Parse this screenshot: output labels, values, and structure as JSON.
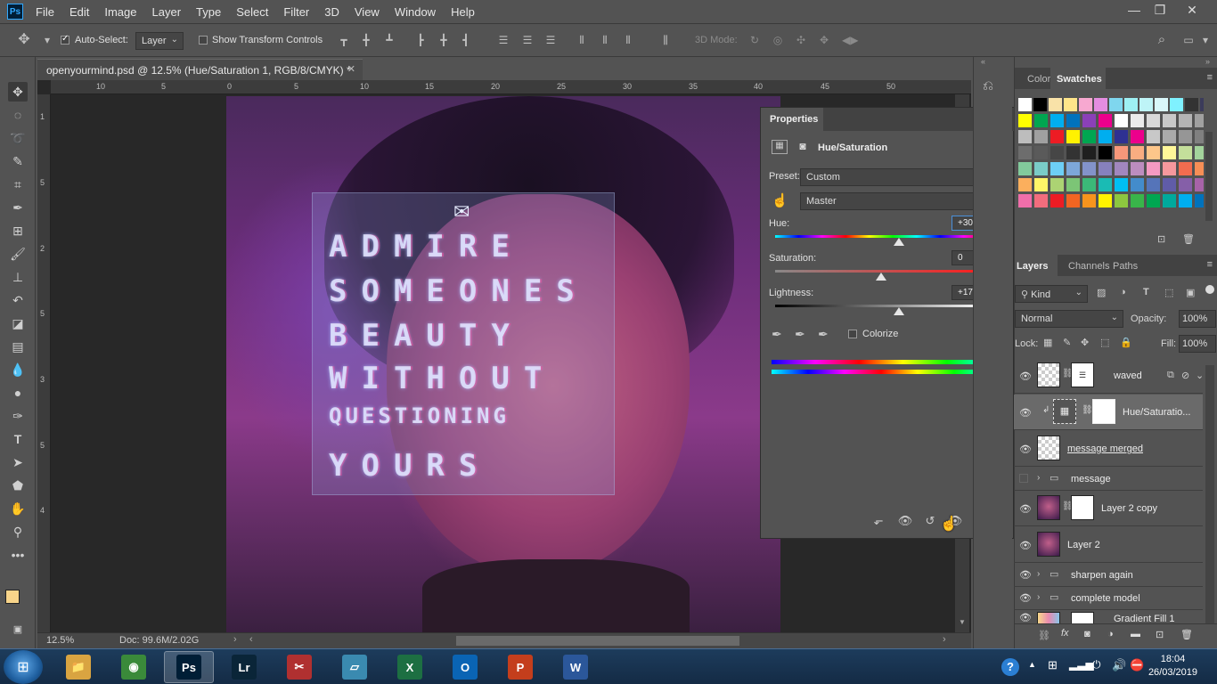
{
  "app": {
    "logo": "Ps"
  },
  "menu": [
    "File",
    "Edit",
    "Image",
    "Layer",
    "Type",
    "Select",
    "Filter",
    "3D",
    "View",
    "Window",
    "Help"
  ],
  "window_controls": {
    "minimize": "—",
    "restore": "❐",
    "close": "✕"
  },
  "options": {
    "auto_select_label": "Auto-Select:",
    "auto_select_checked": true,
    "auto_select_target": "Layer",
    "show_transform_label": "Show Transform Controls",
    "show_transform_checked": false,
    "mode_3d_label": "3D Mode:"
  },
  "document": {
    "tab_title": "openyourmind.psd @ 12.5% (Hue/Saturation 1, RGB/8/CMYK) *",
    "ruler_h": [
      "10",
      "5",
      "0",
      "5",
      "10",
      "15",
      "20",
      "25",
      "30",
      "35",
      "40",
      "45",
      "50"
    ],
    "ruler_v": [
      "1",
      "5",
      "2",
      "5",
      "3",
      "5",
      "4"
    ],
    "message_lines": [
      "ADMIRE",
      "SOMEONES",
      "BEAUTY",
      "WITHOUT",
      "QUESTIONING",
      "YOURS"
    ],
    "zoom": "12.5%",
    "doc_info": "Doc: 99.6M/2.02G"
  },
  "properties": {
    "tab": "Properties",
    "adjustment_title": "Hue/Saturation",
    "preset_label": "Preset:",
    "preset_value": "Custom",
    "channel_value": "Master",
    "hue_label": "Hue:",
    "hue_value": "+30",
    "hue_level": 30,
    "saturation_label": "Saturation:",
    "saturation_value": "0",
    "saturation_level": 0,
    "lightness_label": "Lightness:",
    "lightness_value": "+17",
    "lightness_level": 17,
    "colorize_label": "Colorize",
    "colorize_checked": false
  },
  "color_panel": {
    "tabs": [
      "Color",
      "Swatches"
    ],
    "active": "Swatches"
  },
  "swatch_rows": [
    [
      "#ffffff",
      "#000000",
      "#f9e2a8",
      "#ffe58a",
      "#f7a8d0",
      "#e48de0",
      "#7fd6ee",
      "#9ef0f3",
      "#bef4f7",
      "#d9f7fa",
      "#7ff1ff",
      "#333333",
      "#3b3b5b",
      "#5a6aa0"
    ],
    [
      "#ffff00",
      "#00a650",
      "#00aeef",
      "#0072bc",
      "#8b40b8",
      "#ec008c",
      "#ffffff",
      "#ebebeb",
      "#d9d9d9",
      "#c8c8c8",
      "#b4b4b4",
      "#a0a0a0"
    ],
    [
      "#bdbdbd",
      "#a0a0a0",
      "#ed1c24",
      "#fff200",
      "#00a651",
      "#00aeef",
      "#2e3192",
      "#ec008c",
      "#c8c8c8",
      "#aaaaaa",
      "#969696",
      "#808080"
    ],
    [
      "#6d6d6d",
      "#5a5a5a",
      "#464646",
      "#333333",
      "#1f1f1f",
      "#000000",
      "#f6977a",
      "#f9ad81",
      "#fdc68a",
      "#fff799",
      "#c4df9b",
      "#a3d39c"
    ],
    [
      "#82ca9c",
      "#7accc8",
      "#6dcff6",
      "#7da7d9",
      "#8393ca",
      "#8781bd",
      "#a187be",
      "#bc8dbf",
      "#f49ac2",
      "#f6989d",
      "#f26c4f",
      "#f68e56"
    ],
    [
      "#fbaf5d",
      "#fff568",
      "#acd373",
      "#7cc576",
      "#3bb878",
      "#1abbb4",
      "#00bff3",
      "#438ccb",
      "#5574b9",
      "#605ca8",
      "#855fa8",
      "#a763a8"
    ],
    [
      "#f06eaa",
      "#f26d7d",
      "#ed1c24",
      "#f26522",
      "#f7941d",
      "#fff200",
      "#8dc73f",
      "#39b54a",
      "#00a651",
      "#00a99d",
      "#00aeef",
      "#0072bc"
    ]
  ],
  "layers_panel": {
    "tabs": [
      "Layers",
      "Channels",
      "Paths"
    ],
    "active": "Layers",
    "filter_label": "Kind",
    "blend_mode": "Normal",
    "opacity_label": "Opacity:",
    "opacity_value": "100%",
    "lock_label": "Lock:",
    "fill_label": "Fill:",
    "fill_value": "100%",
    "layers": [
      {
        "name": "waved",
        "visible": true,
        "kind": "smart"
      },
      {
        "name": "Hue/Saturatio...",
        "visible": true,
        "kind": "adjustment",
        "selected": true
      },
      {
        "name": "message merged",
        "visible": true,
        "kind": "smart"
      },
      {
        "name": "message",
        "visible": false,
        "kind": "group"
      },
      {
        "name": "Layer 2 copy",
        "visible": true,
        "kind": "masked"
      },
      {
        "name": "Layer 2",
        "visible": true,
        "kind": "image"
      },
      {
        "name": "sharpen again",
        "visible": true,
        "kind": "group"
      },
      {
        "name": "complete model",
        "visible": true,
        "kind": "group"
      },
      {
        "name": "Gradient Fill 1",
        "visible": true,
        "kind": "fill"
      }
    ]
  },
  "taskbar": {
    "apps": [
      {
        "name": "explorer",
        "label": "📁",
        "color": "#d9a441"
      },
      {
        "name": "chrome",
        "label": "◉",
        "color": "#3a8a3a"
      },
      {
        "name": "photoshop",
        "label": "Ps",
        "color": "#001e36",
        "active": true
      },
      {
        "name": "lightroom",
        "label": "Lr",
        "color": "#0a2538"
      },
      {
        "name": "snipping",
        "label": "✂",
        "color": "#b03030"
      },
      {
        "name": "notes",
        "label": "▱",
        "color": "#3a8ab0"
      },
      {
        "name": "excel",
        "label": "X",
        "color": "#1d6f42"
      },
      {
        "name": "outlook",
        "label": "O",
        "color": "#0a64b4"
      },
      {
        "name": "powerpoint",
        "label": "P",
        "color": "#c43e1c"
      },
      {
        "name": "word",
        "label": "W",
        "color": "#2b579a"
      }
    ],
    "time": "18:04",
    "date": "26/03/2019"
  }
}
